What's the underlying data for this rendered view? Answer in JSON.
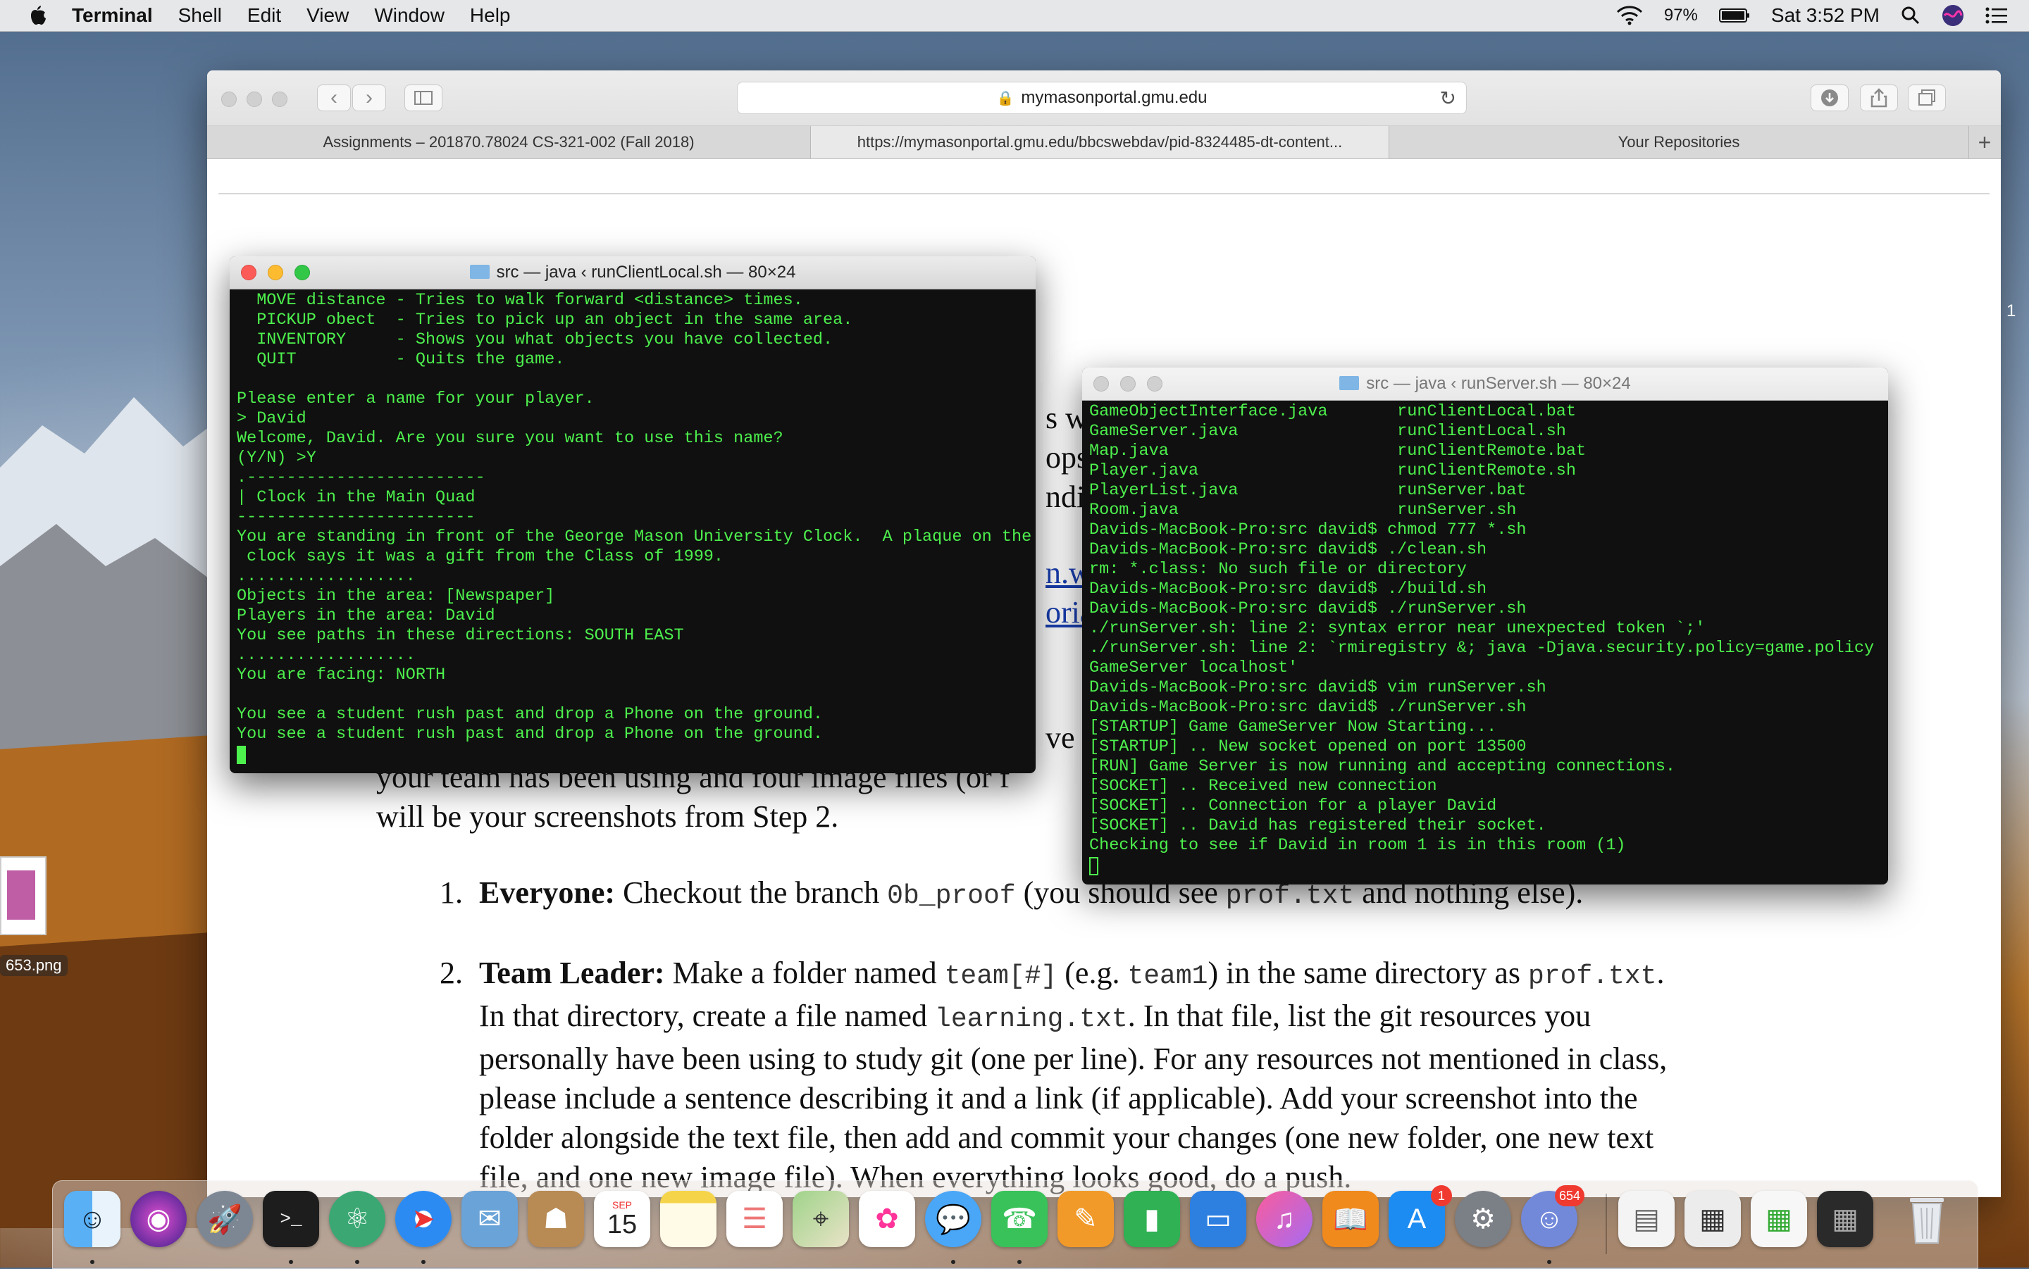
{
  "menubar": {
    "app": "Terminal",
    "items": [
      "Shell",
      "Edit",
      "View",
      "Window",
      "Help"
    ],
    "battery": "97%",
    "clock": "Sat 3:52 PM"
  },
  "safari": {
    "url": "mymasonportal.gmu.edu",
    "tabs": [
      "Assignments – 201870.78024 CS-321-002 (Fall 2018)",
      "https://mymasonportal.gmu.edu/bbcswebdav/pid-8324485-dt-content...",
      "Your Repositories"
    ]
  },
  "doc": {
    "frag_top1": "s wi",
    "frag_top2": "ops”",
    "frag_top3": "ndi",
    "frag_link1": "n.wi",
    "frag_link2": "oria",
    "frag_have": "ve a",
    "line_team": "your team has been using and four image files (or f",
    "line_screens": "will be your screenshots from Step 2.",
    "step1_num": "1.",
    "step1_bold": "Everyone:",
    "step1_text1": " Checkout the branch ",
    "step1_code1": "0b_proof",
    "step1_text2": " (you should see ",
    "step1_code2": "prof.txt",
    "step1_text3": " and nothing else).",
    "step2_num": "2.",
    "step2_bold": "Team Leader:",
    "step2_text1": " Make a folder named ",
    "step2_code1": "team[#]",
    "step2_text2": " (e.g. ",
    "step2_code2": "team1",
    "step2_text3": ") in the same directory as ",
    "step2_code3": "prof.txt",
    "step2_text4": ".",
    "step2_l2a": "In that directory, create a file named ",
    "step2_l2code": "learning.txt",
    "step2_l2b": ". In that file, list the git resources you",
    "step2_l3": "personally have been using to study git (one per line). For any resources not mentioned in class,",
    "step2_l4": "please include a sentence describing it and a link (if applicable). Add your screenshot into the",
    "step2_l5": "folder alongside the text file, then add and commit your changes (one new folder, one new text",
    "step2_l6": "file, and one new image file). When everything looks good, do a push."
  },
  "client_terminal": {
    "title": "src — java ‹ runClientLocal.sh — 80×24",
    "lines": [
      "  MOVE distance - Tries to walk forward <distance> times.",
      "  PICKUP obect  - Tries to pick up an object in the same area.",
      "  INVENTORY     - Shows you what objects you have collected.",
      "  QUIT          - Quits the game.",
      "",
      "Please enter a name for your player.",
      "> David",
      "Welcome, David. Are you sure you want to use this name?",
      "(Y/N) >Y",
      ".------------------------",
      "| Clock in the Main Quad",
      "------------------------",
      "You are standing in front of the George Mason University Clock.  A plaque on the",
      " clock says it was a gift from the Class of 1999.",
      "..................",
      "Objects in the area: [Newspaper]",
      "Players in the area: David",
      "You see paths in these directions: SOUTH EAST",
      "..................",
      "You are facing: NORTH",
      "",
      "You see a student rush past and drop a Phone on the ground.",
      "You see a student rush past and drop a Phone on the ground."
    ]
  },
  "server_terminal": {
    "title": "src — java ‹ runServer.sh — 80×24",
    "lines": [
      "GameObjectInterface.java       runClientLocal.bat",
      "GameServer.java                runClientLocal.sh",
      "Map.java                       runClientRemote.bat",
      "Player.java                    runClientRemote.sh",
      "PlayerList.java                runServer.bat",
      "Room.java                      runServer.sh",
      "Davids-MacBook-Pro:src david$ chmod 777 *.sh",
      "Davids-MacBook-Pro:src david$ ./clean.sh",
      "rm: *.class: No such file or directory",
      "Davids-MacBook-Pro:src david$ ./build.sh",
      "Davids-MacBook-Pro:src david$ ./runServer.sh",
      "./runServer.sh: line 2: syntax error near unexpected token `;'",
      "./runServer.sh: line 2: `rmiregistry &; java -Djava.security.policy=game.policy",
      "GameServer localhost'",
      "Davids-MacBook-Pro:src david$ vim runServer.sh",
      "Davids-MacBook-Pro:src david$ ./runServer.sh",
      "[STARTUP] Game GameServer Now Starting...",
      "[STARTUP] .. New socket opened on port 13500",
      "[RUN] Game Server is now running and accepting connections.",
      "[SOCKET] .. Received new connection",
      "[SOCKET] .. Connection for a player David",
      "[SOCKET] .. David has registered their socket.",
      "Checking to see if David in room 1 is in this room (1)"
    ]
  },
  "desktop": {
    "file_label": "653.png"
  },
  "dock": {
    "calendar_month": "SEP",
    "calendar_day": "15",
    "appstore_badge": "1",
    "discord_badge": "654"
  }
}
